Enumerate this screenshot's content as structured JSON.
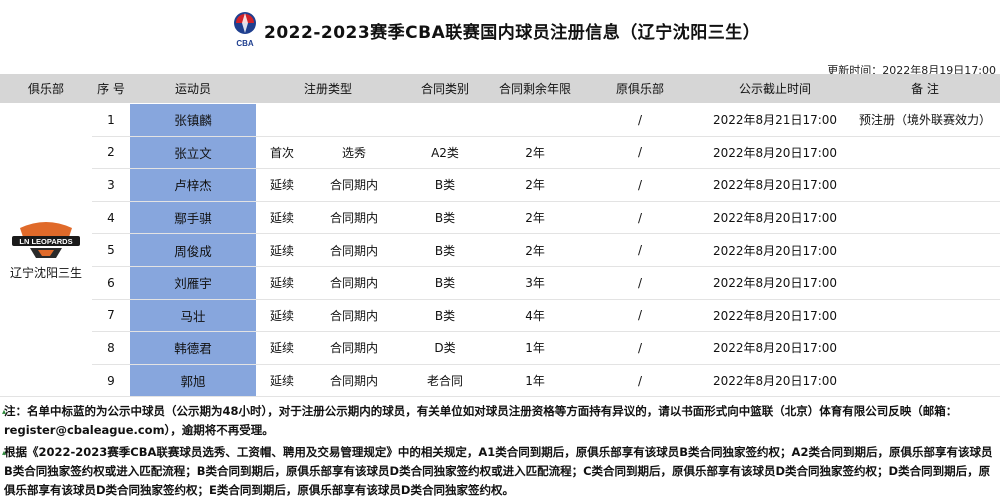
{
  "header": {
    "logo_text": "CBA",
    "title": "2022-2023赛季CBA联赛国内球员注册信息（辽宁沈阳三生）",
    "update_time": "更新时间：2022年8月19日17:00"
  },
  "columns": [
    "俱乐部",
    "序 号",
    "运动员",
    "注册类型",
    "",
    "合同类别",
    "合同剩余年限",
    "原俱乐部",
    "公示截止时间",
    "备 注"
  ],
  "club": {
    "name": "辽宁沈阳三生",
    "logo_text": "LN LEOPARDS"
  },
  "rows": [
    {
      "no": "1",
      "player": "张镇麟",
      "reg1": "",
      "reg2": "",
      "contract": "",
      "years": "",
      "orig": "/",
      "deadline": "2022年8月21日17:00",
      "remark": "预注册（境外联赛效力）"
    },
    {
      "no": "2",
      "player": "张立文",
      "reg1": "首次",
      "reg2": "选秀",
      "contract": "A2类",
      "years": "2年",
      "orig": "/",
      "deadline": "2022年8月20日17:00",
      "remark": ""
    },
    {
      "no": "3",
      "player": "卢梓杰",
      "reg1": "延续",
      "reg2": "合同期内",
      "contract": "B类",
      "years": "2年",
      "orig": "/",
      "deadline": "2022年8月20日17:00",
      "remark": ""
    },
    {
      "no": "4",
      "player": "鄢手骐",
      "reg1": "延续",
      "reg2": "合同期内",
      "contract": "B类",
      "years": "2年",
      "orig": "/",
      "deadline": "2022年8月20日17:00",
      "remark": ""
    },
    {
      "no": "5",
      "player": "周俊成",
      "reg1": "延续",
      "reg2": "合同期内",
      "contract": "B类",
      "years": "2年",
      "orig": "/",
      "deadline": "2022年8月20日17:00",
      "remark": ""
    },
    {
      "no": "6",
      "player": "刘雁宇",
      "reg1": "延续",
      "reg2": "合同期内",
      "contract": "B类",
      "years": "3年",
      "orig": "/",
      "deadline": "2022年8月20日17:00",
      "remark": ""
    },
    {
      "no": "7",
      "player": "马壮",
      "reg1": "延续",
      "reg2": "合同期内",
      "contract": "B类",
      "years": "4年",
      "orig": "/",
      "deadline": "2022年8月20日17:00",
      "remark": ""
    },
    {
      "no": "8",
      "player": "韩德君",
      "reg1": "延续",
      "reg2": "合同期内",
      "contract": "D类",
      "years": "1年",
      "orig": "/",
      "deadline": "2022年8月20日17:00",
      "remark": ""
    },
    {
      "no": "9",
      "player": "郭旭",
      "reg1": "延续",
      "reg2": "合同期内",
      "contract": "老合同",
      "years": "1年",
      "orig": "/",
      "deadline": "2022年8月20日17:00",
      "remark": ""
    }
  ],
  "notes": {
    "note1": "注：名单中标蓝的为公示中球员（公示期为48小时），对于注册公示期内的球员，有关单位如对球员注册资格等方面持有异议的，请以书面形式向中篮联（北京）体育有限公司反映（邮箱：register@cbaleague.com），逾期将不再受理。",
    "note2": "根据《2022-2023赛季CBA联赛球员选秀、工资帽、聘用及交易管理规定》中的相关规定，A1类合同到期后，原俱乐部享有该球员B类合同独家签约权；A2类合同到期后，原俱乐部享有该球员B类合同独家签约权或进入匹配流程；B类合同到期后，原俱乐部享有该球员D类合同独家签约权或进入匹配流程；C类合同到期后，原俱乐部享有该球员D类合同独家签约权；D类合同到期后，原俱乐部享有该球员D类合同独家签约权；E类合同到期后，原俱乐部享有该球员D类合同独家签约权。"
  },
  "colors": {
    "header_bg": "#d6d6d6",
    "player_highlight": "#87a6dd",
    "logo_red": "#d1232a",
    "logo_orange": "#e06a2a"
  }
}
